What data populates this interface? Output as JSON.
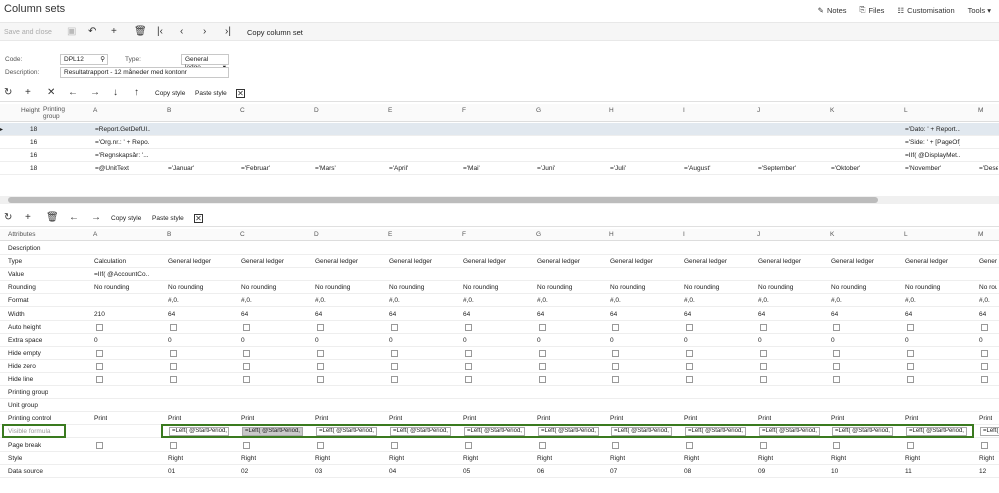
{
  "header": {
    "title": "Column sets",
    "actions": [
      "Notes",
      "Files",
      "Customisation",
      "Tools ▾"
    ]
  },
  "toolbar": {
    "save_close": "Save and close",
    "copy_column_set": "Copy column set"
  },
  "form": {
    "code_label": "Code:",
    "code_value": "DPL12",
    "type_label": "Type:",
    "type_value": "General ledge",
    "desc_label": "Description:",
    "desc_value": "Resultatrapport - 12 måneder med kontonr"
  },
  "grid1": {
    "copy_style": "Copy style",
    "paste_style": "Paste style",
    "col_height": "Height",
    "col_printing": "Printing group",
    "columns": [
      "A",
      "B",
      "C",
      "D",
      "E",
      "F",
      "G",
      "H",
      "I",
      "J",
      "K",
      "L",
      "M"
    ],
    "rows": [
      {
        "height": "18",
        "a": "=Report.GetDefUI...",
        "l": "='Dato: ' + Report..."
      },
      {
        "height": "16",
        "a": "='Org.nr.: ' + Repo...",
        "l": "='Side: ' + [PageOf]"
      },
      {
        "height": "16",
        "a": "='Regnskapsår: '...",
        "l": "=IIf( @DisplayMet..."
      },
      {
        "height": "18",
        "a": "=@UnitText",
        "months": [
          "='Januar'",
          "='Februar'",
          "='Mars'",
          "='April'",
          "='Mai'",
          "='Juni'",
          "='Juli'",
          "='August'",
          "='September'",
          "='Oktober'",
          "='November'",
          "='Dese"
        ]
      }
    ]
  },
  "grid2": {
    "copy_style": "Copy style",
    "paste_style": "Paste style",
    "col_attributes": "Attributes",
    "columns": [
      "A",
      "B",
      "C",
      "D",
      "E",
      "F",
      "G",
      "H",
      "I",
      "J",
      "K",
      "L",
      "M"
    ],
    "attributes": [
      "Description",
      "Type",
      "Value",
      "Rounding",
      "Format",
      "Width",
      "Auto height",
      "Extra space",
      "Hide empty",
      "Hide zero",
      "Hide line",
      "Printing group",
      "Unit group",
      "Printing control",
      "Visible formula",
      "Page break",
      "Style",
      "Data source"
    ],
    "type_a": "Calculation",
    "type_other": "General ledger",
    "value_a": "=IIf( @AccountCo...",
    "rounding": "No rounding",
    "format": "#,0.",
    "width_a": "210",
    "width_other": "64",
    "extra_space": "0",
    "print": "Print",
    "vf_value": "=Left( @StartPeriod, 2...",
    "vf_m": "=Left(",
    "style": "Right",
    "data_sources": [
      "01",
      "02",
      "03",
      "04",
      "05",
      "06",
      "07",
      "08",
      "09",
      "10",
      "11",
      "12"
    ]
  }
}
